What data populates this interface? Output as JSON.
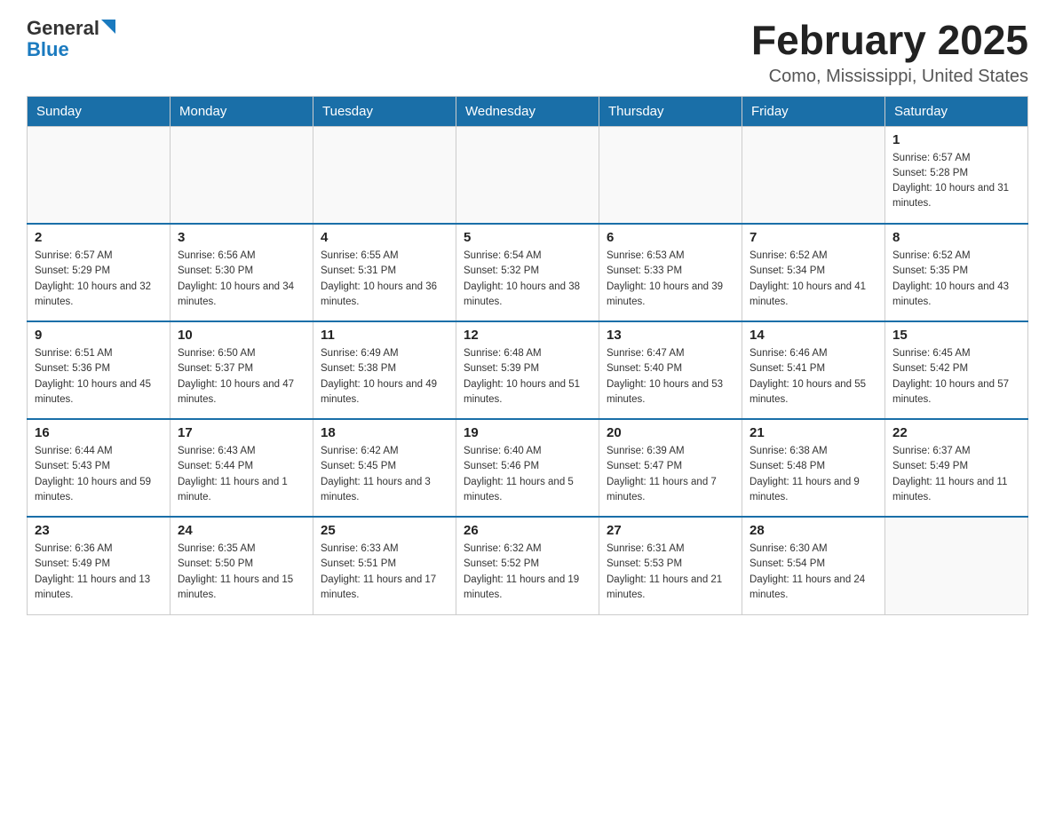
{
  "header": {
    "logo_general": "General",
    "logo_triangle": "▲",
    "logo_blue": "Blue",
    "month_title": "February 2025",
    "location": "Como, Mississippi, United States"
  },
  "days_of_week": [
    "Sunday",
    "Monday",
    "Tuesday",
    "Wednesday",
    "Thursday",
    "Friday",
    "Saturday"
  ],
  "weeks": [
    [
      {
        "day": "",
        "sunrise": "",
        "sunset": "",
        "daylight": ""
      },
      {
        "day": "",
        "sunrise": "",
        "sunset": "",
        "daylight": ""
      },
      {
        "day": "",
        "sunrise": "",
        "sunset": "",
        "daylight": ""
      },
      {
        "day": "",
        "sunrise": "",
        "sunset": "",
        "daylight": ""
      },
      {
        "day": "",
        "sunrise": "",
        "sunset": "",
        "daylight": ""
      },
      {
        "day": "",
        "sunrise": "",
        "sunset": "",
        "daylight": ""
      },
      {
        "day": "1",
        "sunrise": "Sunrise: 6:57 AM",
        "sunset": "Sunset: 5:28 PM",
        "daylight": "Daylight: 10 hours and 31 minutes."
      }
    ],
    [
      {
        "day": "2",
        "sunrise": "Sunrise: 6:57 AM",
        "sunset": "Sunset: 5:29 PM",
        "daylight": "Daylight: 10 hours and 32 minutes."
      },
      {
        "day": "3",
        "sunrise": "Sunrise: 6:56 AM",
        "sunset": "Sunset: 5:30 PM",
        "daylight": "Daylight: 10 hours and 34 minutes."
      },
      {
        "day": "4",
        "sunrise": "Sunrise: 6:55 AM",
        "sunset": "Sunset: 5:31 PM",
        "daylight": "Daylight: 10 hours and 36 minutes."
      },
      {
        "day": "5",
        "sunrise": "Sunrise: 6:54 AM",
        "sunset": "Sunset: 5:32 PM",
        "daylight": "Daylight: 10 hours and 38 minutes."
      },
      {
        "day": "6",
        "sunrise": "Sunrise: 6:53 AM",
        "sunset": "Sunset: 5:33 PM",
        "daylight": "Daylight: 10 hours and 39 minutes."
      },
      {
        "day": "7",
        "sunrise": "Sunrise: 6:52 AM",
        "sunset": "Sunset: 5:34 PM",
        "daylight": "Daylight: 10 hours and 41 minutes."
      },
      {
        "day": "8",
        "sunrise": "Sunrise: 6:52 AM",
        "sunset": "Sunset: 5:35 PM",
        "daylight": "Daylight: 10 hours and 43 minutes."
      }
    ],
    [
      {
        "day": "9",
        "sunrise": "Sunrise: 6:51 AM",
        "sunset": "Sunset: 5:36 PM",
        "daylight": "Daylight: 10 hours and 45 minutes."
      },
      {
        "day": "10",
        "sunrise": "Sunrise: 6:50 AM",
        "sunset": "Sunset: 5:37 PM",
        "daylight": "Daylight: 10 hours and 47 minutes."
      },
      {
        "day": "11",
        "sunrise": "Sunrise: 6:49 AM",
        "sunset": "Sunset: 5:38 PM",
        "daylight": "Daylight: 10 hours and 49 minutes."
      },
      {
        "day": "12",
        "sunrise": "Sunrise: 6:48 AM",
        "sunset": "Sunset: 5:39 PM",
        "daylight": "Daylight: 10 hours and 51 minutes."
      },
      {
        "day": "13",
        "sunrise": "Sunrise: 6:47 AM",
        "sunset": "Sunset: 5:40 PM",
        "daylight": "Daylight: 10 hours and 53 minutes."
      },
      {
        "day": "14",
        "sunrise": "Sunrise: 6:46 AM",
        "sunset": "Sunset: 5:41 PM",
        "daylight": "Daylight: 10 hours and 55 minutes."
      },
      {
        "day": "15",
        "sunrise": "Sunrise: 6:45 AM",
        "sunset": "Sunset: 5:42 PM",
        "daylight": "Daylight: 10 hours and 57 minutes."
      }
    ],
    [
      {
        "day": "16",
        "sunrise": "Sunrise: 6:44 AM",
        "sunset": "Sunset: 5:43 PM",
        "daylight": "Daylight: 10 hours and 59 minutes."
      },
      {
        "day": "17",
        "sunrise": "Sunrise: 6:43 AM",
        "sunset": "Sunset: 5:44 PM",
        "daylight": "Daylight: 11 hours and 1 minute."
      },
      {
        "day": "18",
        "sunrise": "Sunrise: 6:42 AM",
        "sunset": "Sunset: 5:45 PM",
        "daylight": "Daylight: 11 hours and 3 minutes."
      },
      {
        "day": "19",
        "sunrise": "Sunrise: 6:40 AM",
        "sunset": "Sunset: 5:46 PM",
        "daylight": "Daylight: 11 hours and 5 minutes."
      },
      {
        "day": "20",
        "sunrise": "Sunrise: 6:39 AM",
        "sunset": "Sunset: 5:47 PM",
        "daylight": "Daylight: 11 hours and 7 minutes."
      },
      {
        "day": "21",
        "sunrise": "Sunrise: 6:38 AM",
        "sunset": "Sunset: 5:48 PM",
        "daylight": "Daylight: 11 hours and 9 minutes."
      },
      {
        "day": "22",
        "sunrise": "Sunrise: 6:37 AM",
        "sunset": "Sunset: 5:49 PM",
        "daylight": "Daylight: 11 hours and 11 minutes."
      }
    ],
    [
      {
        "day": "23",
        "sunrise": "Sunrise: 6:36 AM",
        "sunset": "Sunset: 5:49 PM",
        "daylight": "Daylight: 11 hours and 13 minutes."
      },
      {
        "day": "24",
        "sunrise": "Sunrise: 6:35 AM",
        "sunset": "Sunset: 5:50 PM",
        "daylight": "Daylight: 11 hours and 15 minutes."
      },
      {
        "day": "25",
        "sunrise": "Sunrise: 6:33 AM",
        "sunset": "Sunset: 5:51 PM",
        "daylight": "Daylight: 11 hours and 17 minutes."
      },
      {
        "day": "26",
        "sunrise": "Sunrise: 6:32 AM",
        "sunset": "Sunset: 5:52 PM",
        "daylight": "Daylight: 11 hours and 19 minutes."
      },
      {
        "day": "27",
        "sunrise": "Sunrise: 6:31 AM",
        "sunset": "Sunset: 5:53 PM",
        "daylight": "Daylight: 11 hours and 21 minutes."
      },
      {
        "day": "28",
        "sunrise": "Sunrise: 6:30 AM",
        "sunset": "Sunset: 5:54 PM",
        "daylight": "Daylight: 11 hours and 24 minutes."
      },
      {
        "day": "",
        "sunrise": "",
        "sunset": "",
        "daylight": ""
      }
    ]
  ]
}
